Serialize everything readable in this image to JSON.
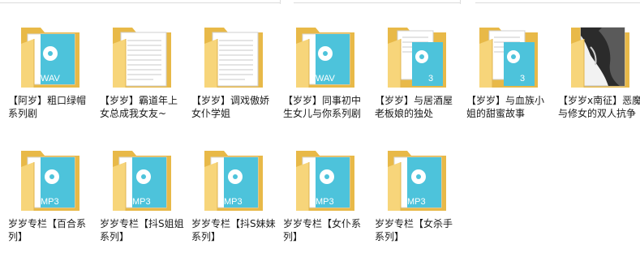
{
  "files": [
    {
      "name": "【阿岁】粗口绿帽系列剧",
      "type": "wav",
      "badge": "WAV"
    },
    {
      "name": "【岁岁】霸道年上女总成我女友~",
      "type": "doc",
      "badge": ""
    },
    {
      "name": "【岁岁】调戏傲娇女仆学姐",
      "type": "doc",
      "badge": ""
    },
    {
      "name": "【岁岁】同事初中生女儿与你系列剧",
      "type": "wav",
      "badge": "WAV"
    },
    {
      "name": "【岁岁】与居酒屋老板娘的独处",
      "type": "mp3doc",
      "badge": "3"
    },
    {
      "name": "【岁岁】与血族小姐的甜蜜故事",
      "type": "mp3doc",
      "badge": "3"
    },
    {
      "name": "【岁岁x南征】恶魔与修女的双人抗争",
      "type": "photo",
      "badge": ""
    },
    {
      "name": "岁岁专栏【百合系列】",
      "type": "mp3",
      "badge": "MP3"
    },
    {
      "name": "岁岁专栏【抖S姐姐系列】",
      "type": "mp3",
      "badge": "MP3"
    },
    {
      "name": "岁岁专栏【抖S妹妹系列】",
      "type": "mp3",
      "badge": "MP3"
    },
    {
      "name": "岁岁专栏【女仆系列】",
      "type": "mp3",
      "badge": "MP3"
    },
    {
      "name": "岁岁专栏【女杀手系列】",
      "type": "mp3",
      "badge": "MP3"
    }
  ],
  "colors": {
    "folder_back": "#E8B948",
    "folder_front": "#F7D57A",
    "media_teal": "#4DC3DB",
    "paper": "#FFFFFF"
  }
}
